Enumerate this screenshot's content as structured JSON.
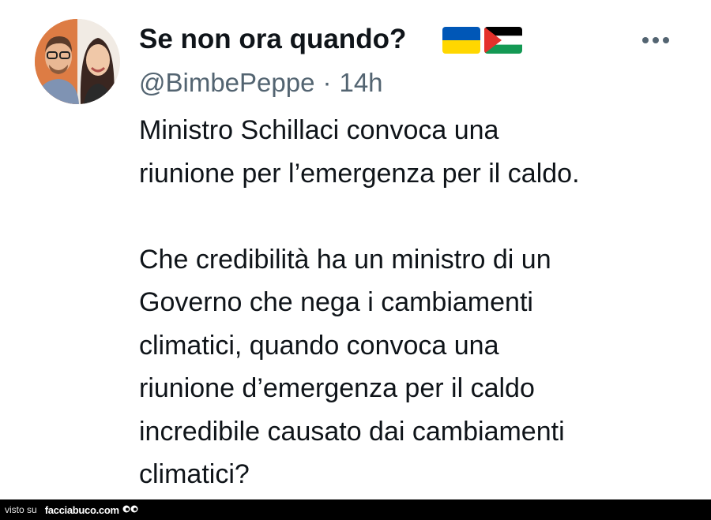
{
  "tweet": {
    "display_name": "Se non ora quando?",
    "handle": "@BimbePeppe",
    "separator": "·",
    "time": "14h",
    "text_lines_p1": [
      "Ministro Schillaci convoca una",
      "riunione per l’emergenza per il caldo."
    ],
    "text_lines_p2": [
      "Che credibilità ha un ministro di un",
      "Governo che nega i cambiamenti",
      "climatici, quando convoca una",
      "riunione d’emergenza per il caldo",
      "incredibile causato dai cambiamenti",
      "climatici?"
    ]
  },
  "icons": {
    "avatar": "profile-photo",
    "flags": [
      "ukraine-flag-icon",
      "palestine-flag-icon"
    ],
    "more": "more-options-icon"
  },
  "colors": {
    "text": "#0f1419",
    "secondary": "#536471",
    "ukraine_blue": "#0057b7",
    "ukraine_yellow": "#ffd700",
    "palestine_red": "#e4312b",
    "palestine_green": "#149954"
  },
  "watermark": {
    "prefix": "visto su",
    "site": "facciabuco.com"
  }
}
